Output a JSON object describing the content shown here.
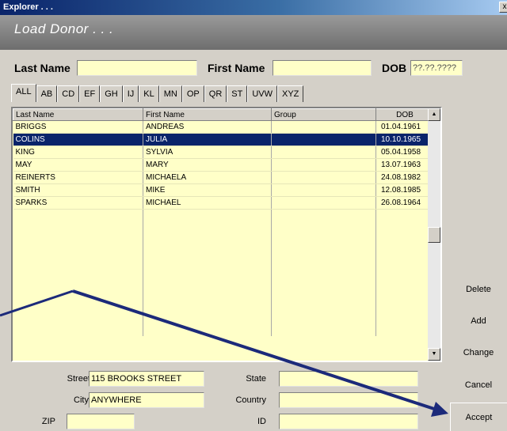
{
  "window": {
    "title": "Explorer . . ."
  },
  "header": {
    "title": "Load Donor . . ."
  },
  "search": {
    "last_name_label": "Last Name",
    "last_name_value": "",
    "first_name_label": "First Name",
    "first_name_value": "",
    "dob_label": "DOB",
    "dob_value": "??.??.????"
  },
  "tabs": [
    {
      "label": "ALL"
    },
    {
      "label": "AB"
    },
    {
      "label": "CD"
    },
    {
      "label": "EF"
    },
    {
      "label": "GH"
    },
    {
      "label": "IJ"
    },
    {
      "label": "KL"
    },
    {
      "label": "MN"
    },
    {
      "label": "OP"
    },
    {
      "label": "QR"
    },
    {
      "label": "ST"
    },
    {
      "label": "UVW"
    },
    {
      "label": "XYZ"
    }
  ],
  "table": {
    "columns": [
      "Last Name",
      "First Name",
      "Group",
      "DOB"
    ],
    "rows": [
      {
        "last": "BRIGGS",
        "first": "ANDREAS",
        "group": "",
        "dob": "01.04.1961",
        "selected": false
      },
      {
        "last": "COLINS",
        "first": "JULIA",
        "group": "",
        "dob": "10.10.1965",
        "selected": true
      },
      {
        "last": "KING",
        "first": "SYLVIA",
        "group": "",
        "dob": "05.04.1958",
        "selected": false
      },
      {
        "last": "MAY",
        "first": "MARY",
        "group": "",
        "dob": "13.07.1963",
        "selected": false
      },
      {
        "last": "REINERTS",
        "first": "MICHAELA",
        "group": "",
        "dob": "24.08.1982",
        "selected": false
      },
      {
        "last": "SMITH",
        "first": "MIKE",
        "group": "",
        "dob": "12.08.1985",
        "selected": false
      },
      {
        "last": "SPARKS",
        "first": "MICHAEL",
        "group": "",
        "dob": "26.08.1964",
        "selected": false
      }
    ]
  },
  "address": {
    "street_label": "Street",
    "street_value": "115 BROOKS STREET",
    "city_label": "City",
    "city_value": "ANYWHERE",
    "zip_label": "ZIP",
    "zip_value": "",
    "state_label": "State",
    "state_value": "",
    "country_label": "Country",
    "country_value": "",
    "id_label": "ID",
    "id_value": ""
  },
  "buttons": {
    "delete": "Delete",
    "add": "Add",
    "change": "Change",
    "cancel": "Cancel",
    "accept": "Accept"
  },
  "icons": {
    "close": "close-icon",
    "scroll_up": "scroll-up-arrow-icon",
    "scroll_down": "scroll-down-arrow-icon"
  },
  "colors": {
    "field_bg": "#ffffc8",
    "selection": "#0a246a",
    "annotation_arrow": "#1c2a7a"
  }
}
